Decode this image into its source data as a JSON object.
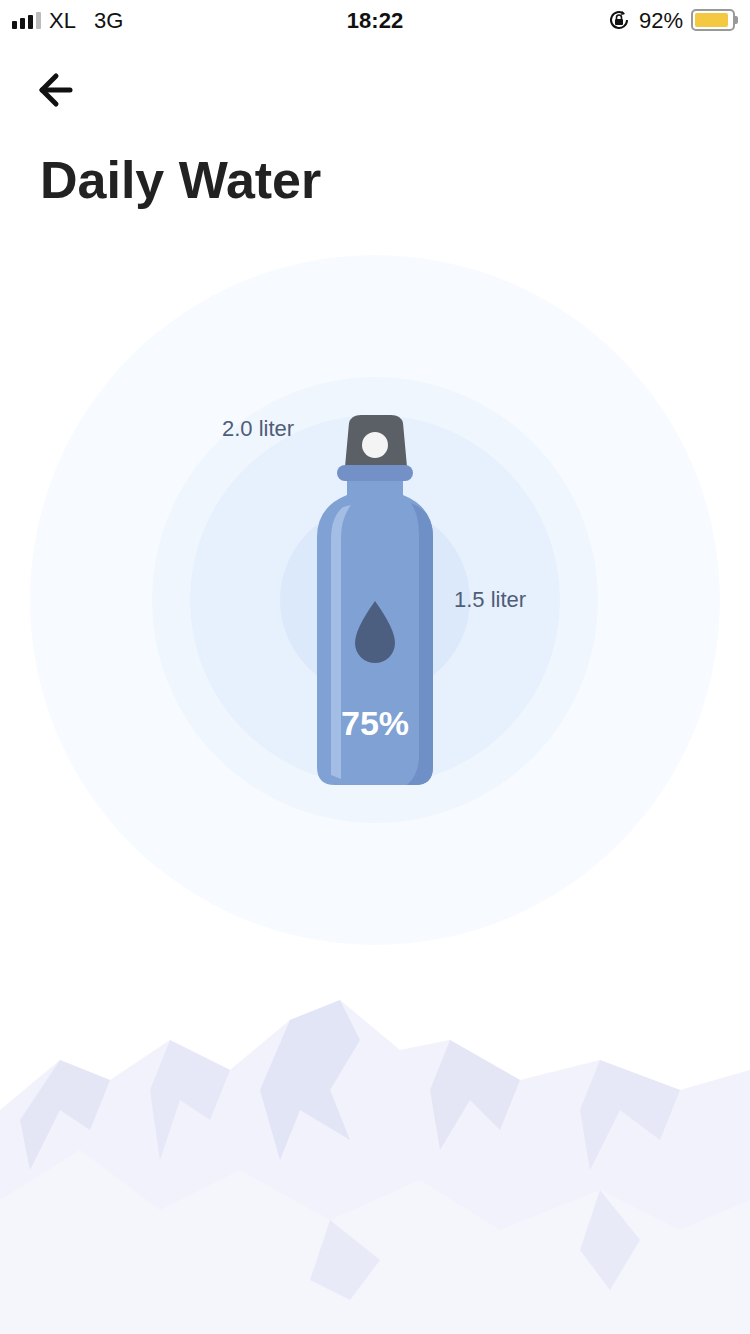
{
  "status_bar": {
    "carrier": "XL",
    "network": "3G",
    "time": "18:22",
    "battery": "92%",
    "signal": {
      "level": 0.75
    },
    "battery_level": 0.92
  },
  "header": {
    "title": "Daily Water"
  },
  "water": {
    "target": "2.0 liter",
    "consumed": "1.5 liter",
    "percent": "75%"
  }
}
